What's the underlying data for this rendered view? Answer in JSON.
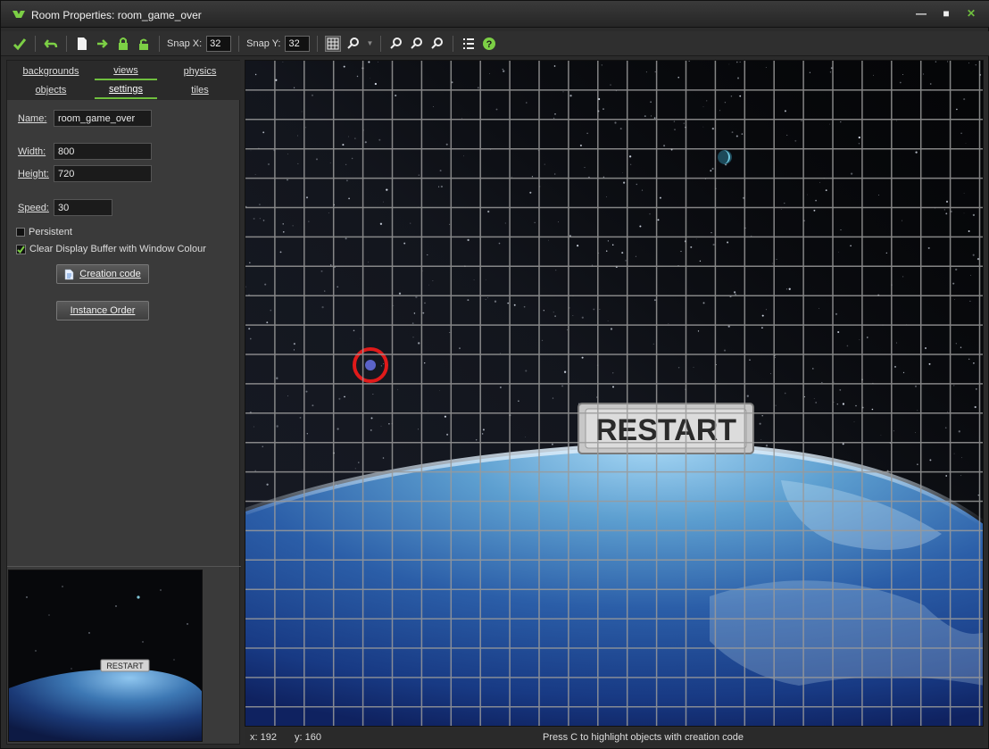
{
  "window": {
    "title": "Room Properties: room_game_over",
    "min_glyph": "—",
    "max_glyph": "■",
    "close_glyph": "✕"
  },
  "toolbar": {
    "snap_x_label": "Snap X:",
    "snap_x_value": "32",
    "snap_y_label": "Snap Y:",
    "snap_y_value": "32"
  },
  "tabs": {
    "backgrounds": "backgrounds",
    "views": "views",
    "physics": "physics",
    "objects": "objects",
    "settings": "settings",
    "tiles": "tiles"
  },
  "settings": {
    "name_label": "Name:",
    "name_value": "room_game_over",
    "width_label": "Width:",
    "width_value": "800",
    "height_label": "Height:",
    "height_value": "720",
    "speed_label": "Speed:",
    "speed_value": "30",
    "persistent_label": "Persistent",
    "persistent_checked": false,
    "clear_display_label": "Clear Display Buffer with Window Colour",
    "clear_display_checked": true,
    "creation_code_button": "Creation code",
    "instance_order_button": "Instance Order"
  },
  "room": {
    "restart_button_text": "RESTART",
    "thumbnail_restart_text": "RESTART"
  },
  "status": {
    "x_label": "x: 192",
    "y_label": "y: 160",
    "hint": "Press C to highlight objects with creation code"
  },
  "colors": {
    "accent": "#6fbf3e",
    "selection_ring": "#e01a1a",
    "grid": "#9a9a9a"
  }
}
